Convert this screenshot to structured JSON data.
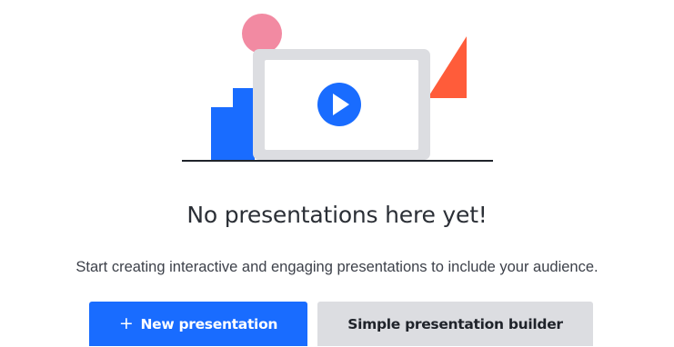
{
  "empty_state": {
    "headline": "No presentations here yet!",
    "description": "Start creating interactive and engaging presentations to include your audience.",
    "illustration_icon": "play-icon"
  },
  "actions": {
    "new_presentation_icon": "+",
    "new_presentation_label": "New presentation",
    "simple_builder_label": "Simple presentation builder"
  },
  "colors": {
    "primary": "#196cff",
    "secondary_button": "#dcdde1",
    "accent_pink": "#f28aa2",
    "accent_orange": "#ff5c3a"
  }
}
